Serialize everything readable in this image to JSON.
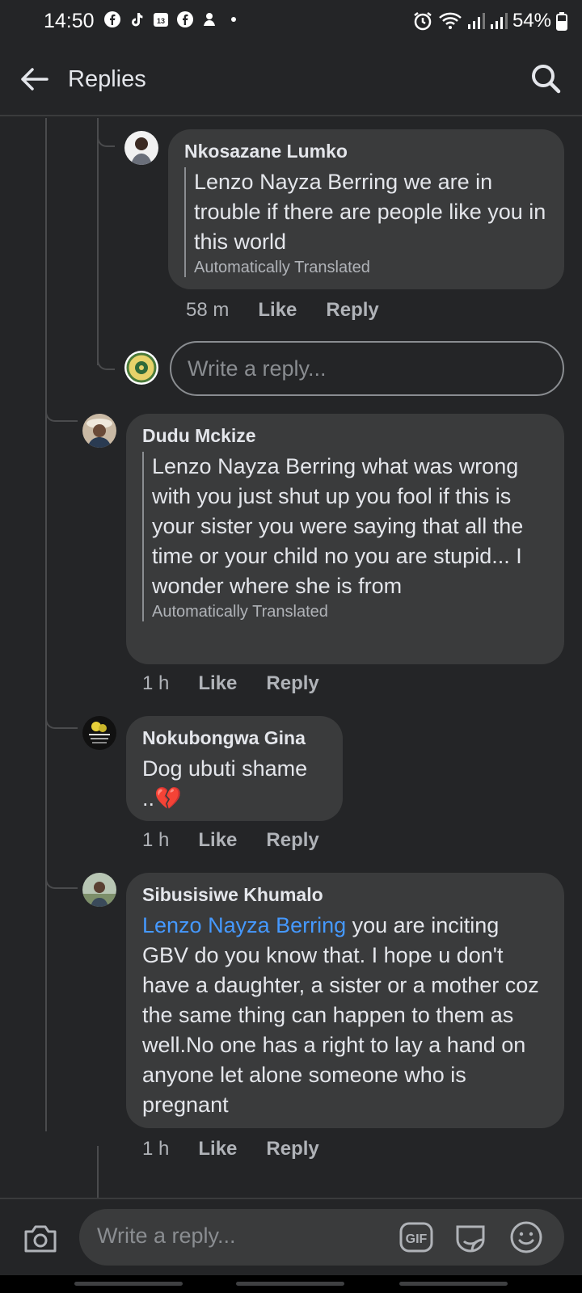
{
  "status_bar": {
    "time": "14:50",
    "battery": "54%"
  },
  "header": {
    "title": "Replies"
  },
  "comments": [
    {
      "author": "Nkosazane Lumko",
      "text": "Lenzo Nayza Berring we are in trouble if there are people like you in this world",
      "translated_label": "Automatically Translated",
      "time": "58 m",
      "like": "Like",
      "reply": "Reply"
    },
    {
      "author": "Dudu Mckize",
      "text": "Lenzo Nayza Berring what was wrong with you just shut up you fool if this is your sister you were saying that all the time or your child no you are stupid... I wonder where she is from",
      "translated_label": "Automatically Translated",
      "time": "1 h",
      "like": "Like",
      "reply": "Reply"
    },
    {
      "author": "Nokubongwa Gina",
      "text": "Dog ubuti shame",
      "text_line2": "..💔",
      "time": "1 h",
      "like": "Like",
      "reply": "Reply"
    },
    {
      "author": "Sibusisiwe Khumalo",
      "mention": "Lenzo Nayza Berring",
      "text": " you are inciting GBV do you know that. I hope u don't have a daughter, a sister or a mother coz the same thing can happen to them as well.No one has a right to lay a hand on anyone let alone someone who is pregnant",
      "time": "1 h",
      "like": "Like",
      "reply": "Reply"
    }
  ],
  "inline_reply": {
    "placeholder": "Write a reply..."
  },
  "composer": {
    "placeholder": "Write a reply...",
    "gif_label": "GIF"
  },
  "colors": {
    "background": "#242527",
    "bubble": "#3a3b3c",
    "mention": "#4599ff",
    "secondary_text": "#b0b3b8"
  }
}
